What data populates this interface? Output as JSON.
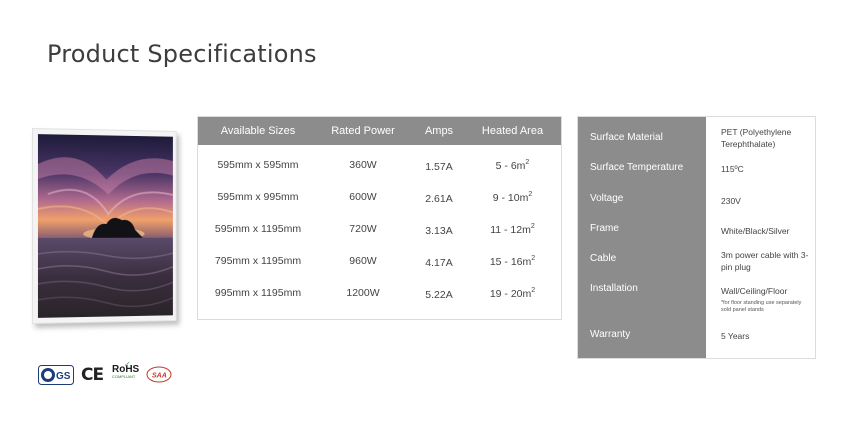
{
  "page": {
    "title": "Product Specifications"
  },
  "sizes_table": {
    "headers": [
      "Available Sizes",
      "Rated Power",
      "Amps",
      "Heated Area"
    ],
    "rows": [
      {
        "size": "595mm x 595mm",
        "power": "360W",
        "amps": "1.57A",
        "area": "5 - 6m",
        "area_unit_sup": "2"
      },
      {
        "size": "595mm x 995mm",
        "power": "600W",
        "amps": "2.61A",
        "area": "9 - 10m",
        "area_unit_sup": "2"
      },
      {
        "size": "595mm x 1195mm",
        "power": "720W",
        "amps": "3.13A",
        "area": "11 - 12m",
        "area_unit_sup": "2"
      },
      {
        "size": "795mm x 1195mm",
        "power": "960W",
        "amps": "4.17A",
        "area": "15 - 16m",
        "area_unit_sup": "2"
      },
      {
        "size": "995mm x 1195mm",
        "power": "1200W",
        "amps": "5.22A",
        "area": "19 - 20m",
        "area_unit_sup": "2"
      }
    ]
  },
  "spec_table": {
    "rows": [
      {
        "label": "Surface Material",
        "value": "PET (Polyethylene Terephthalate)"
      },
      {
        "label": "Surface Temperature",
        "value": "115ºC"
      },
      {
        "label": "Voltage",
        "value": "230V"
      },
      {
        "label": "Frame",
        "value": "White/Black/Silver"
      },
      {
        "label": "Cable",
        "value": "3m  power cable with 3-pin plug"
      },
      {
        "label": "Installation",
        "value": "Wall/Ceiling/Floor",
        "note": "*for floor standing use separately sold panel stands"
      },
      {
        "label": "Warranty",
        "value": "5 Years"
      }
    ]
  },
  "certifications": {
    "logos": [
      "tuv-gs-logo",
      "ce-mark",
      "rohs-logo",
      "saa-logo"
    ],
    "ce_text": "CE",
    "rohs_text": "RoHS",
    "rohs_sub": "COMPLIANT",
    "gs_text": "GS",
    "saa_text": "SAA"
  },
  "colors": {
    "header_gray": "#8c8c8c",
    "title_color": "#3d3d3d",
    "border": "#dcdcdc"
  }
}
